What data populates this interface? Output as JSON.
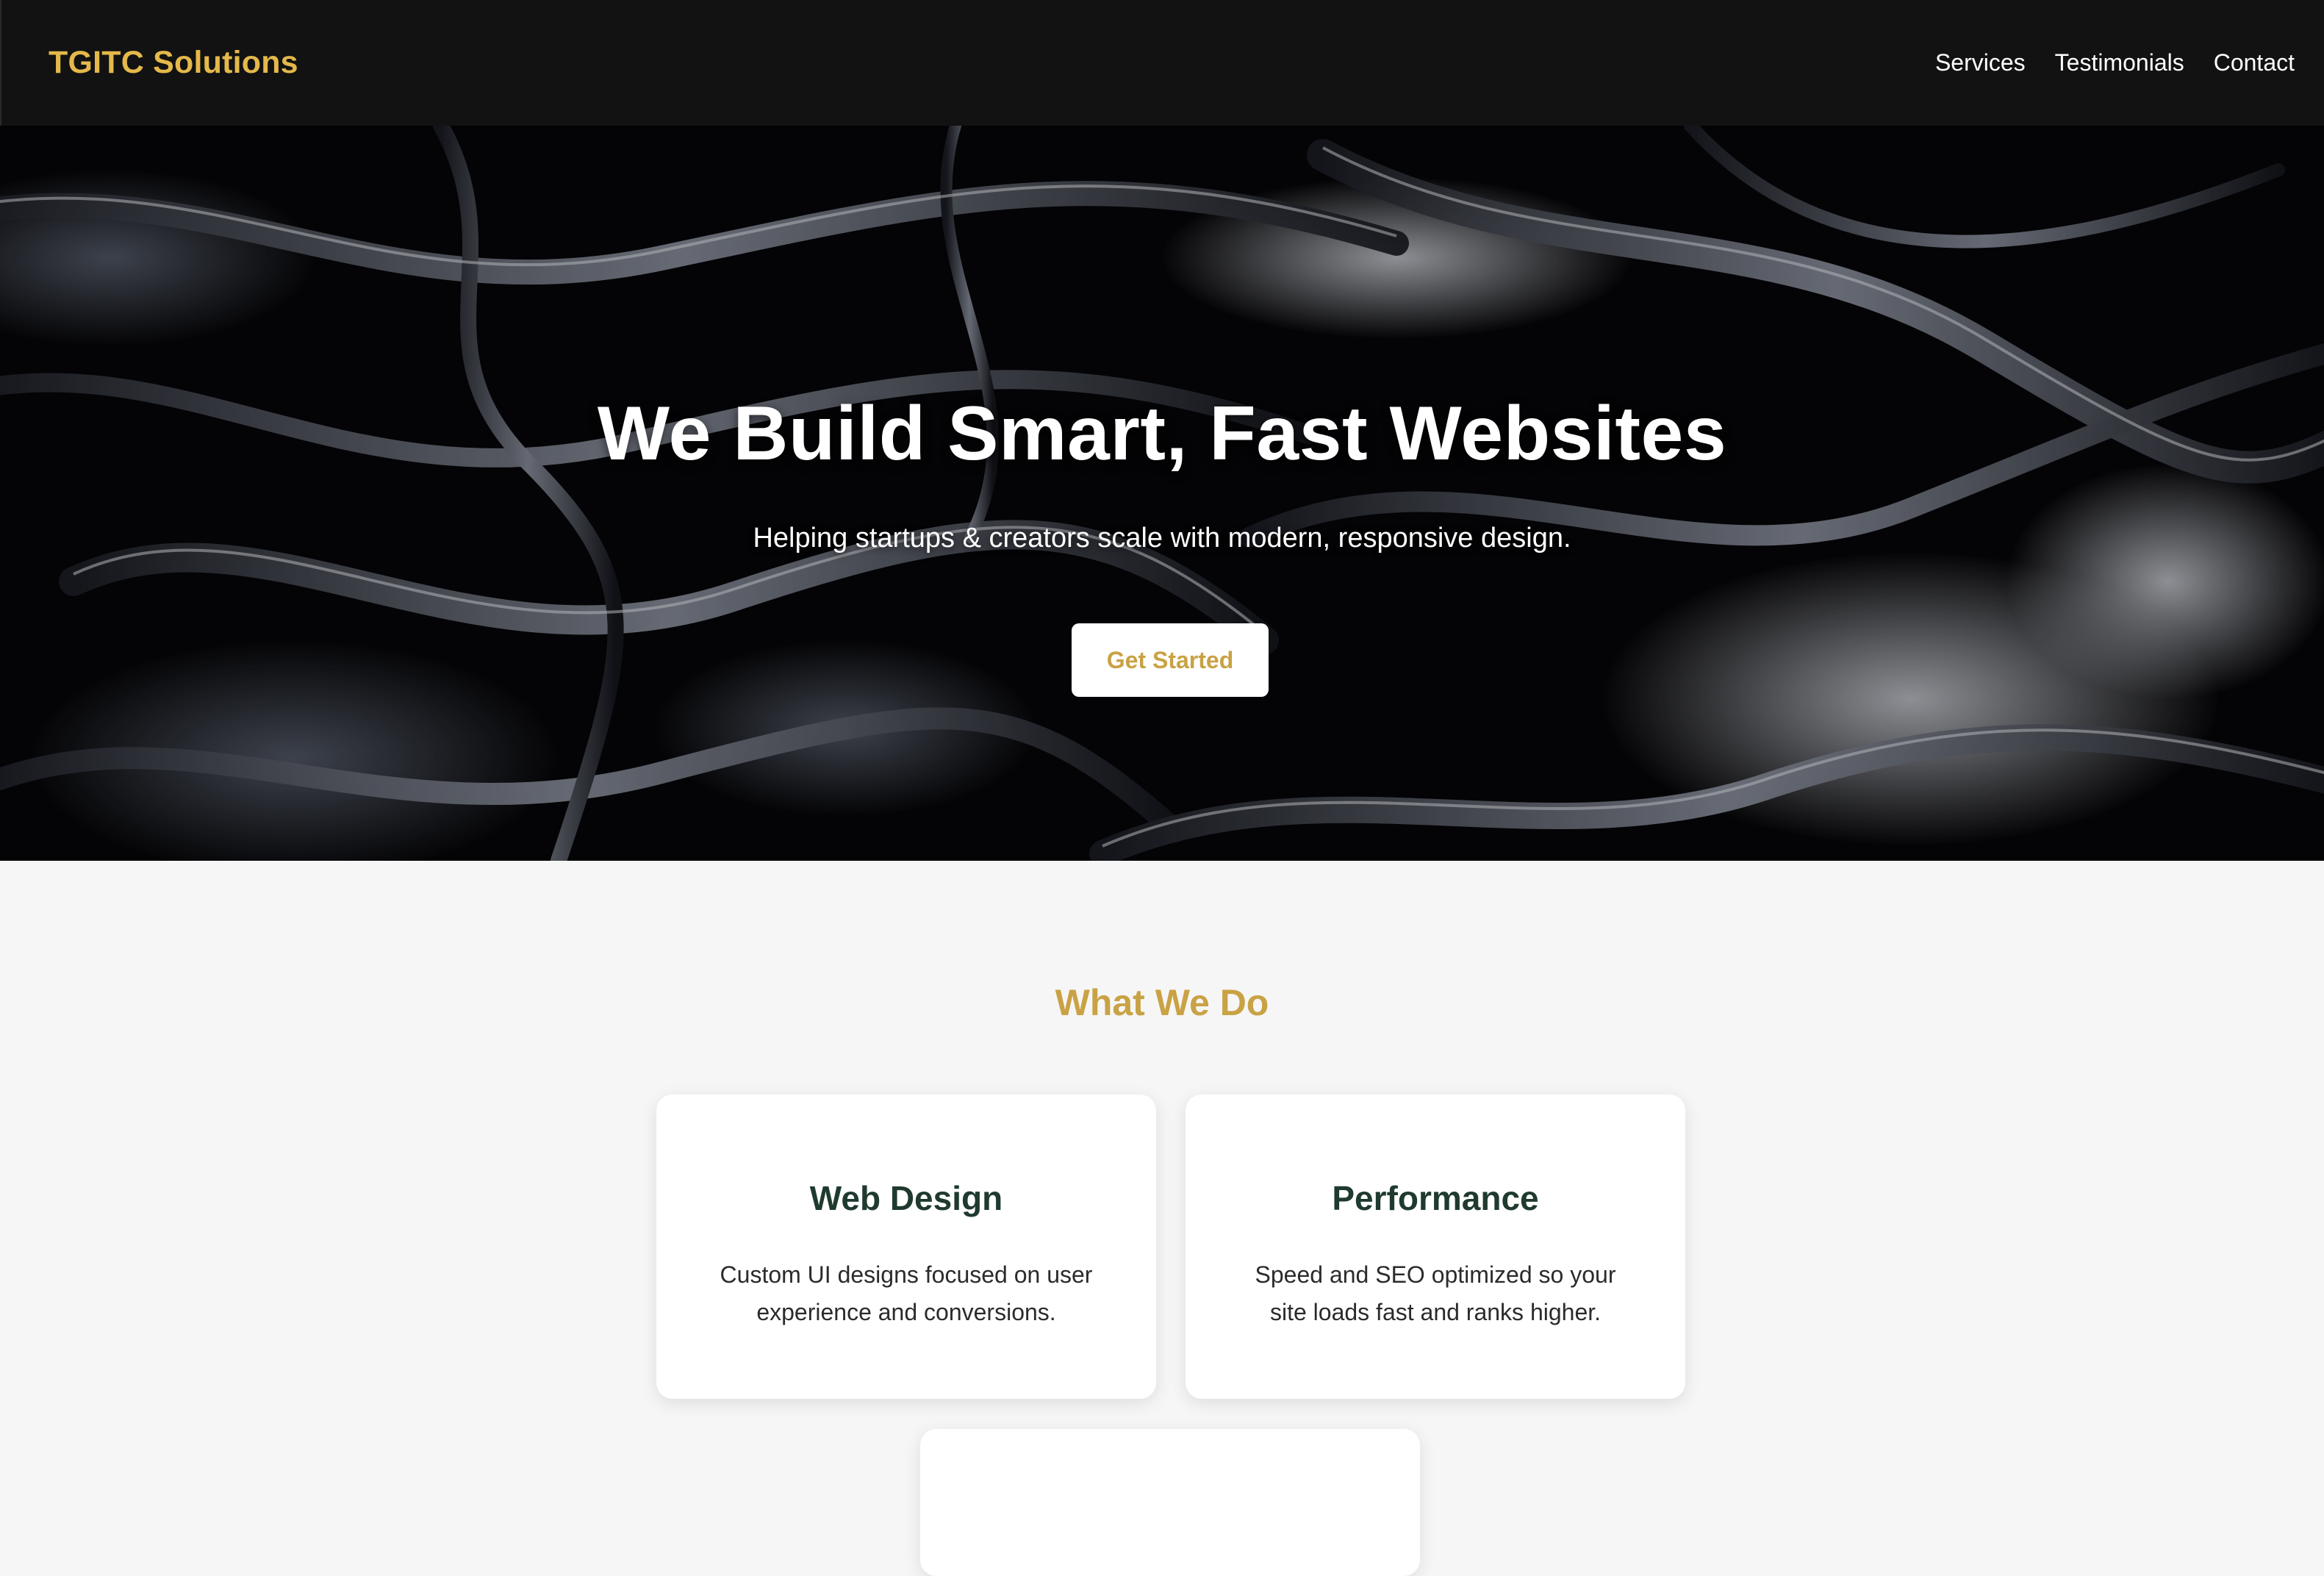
{
  "colors": {
    "accent": "#c9a244",
    "brand": "#e4b84a",
    "nav_bg": "#121212",
    "card_heading": "#1f3a2e",
    "page_bg": "#f6f6f6"
  },
  "nav": {
    "brand": "TGITC Solutions",
    "links": [
      "Services",
      "Testimonials",
      "Contact"
    ]
  },
  "hero": {
    "background": "dark abstract liquid-metal image",
    "title": "We Build Smart, Fast Websites",
    "subtitle": "Helping startups & creators scale with modern, responsive design.",
    "cta_label": "Get Started"
  },
  "services": {
    "title": "What We Do",
    "cards": [
      {
        "title": "Web Design",
        "text": "Custom UI designs focused on user experience and conversions."
      },
      {
        "title": "Performance",
        "text": "Speed and SEO optimized so your site loads fast and ranks higher."
      }
    ]
  }
}
